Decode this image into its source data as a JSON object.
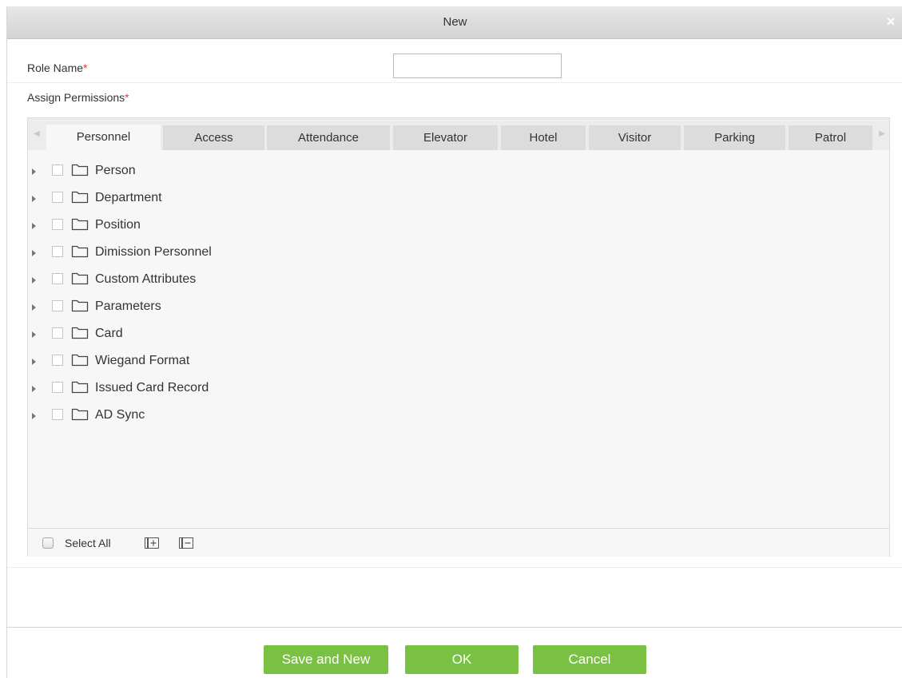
{
  "dialog": {
    "title": "New",
    "close_glyph": "×"
  },
  "form": {
    "role_name_label": "Role Name",
    "required_mark": "*",
    "role_name_value": "",
    "assign_label": "Assign Permissions"
  },
  "tabs": [
    {
      "label": "Personnel",
      "active": true
    },
    {
      "label": "Access"
    },
    {
      "label": "Attendance"
    },
    {
      "label": "Elevator"
    },
    {
      "label": "Hotel"
    },
    {
      "label": "Visitor"
    },
    {
      "label": "Parking"
    },
    {
      "label": "Patrol"
    }
  ],
  "tree": {
    "items": [
      {
        "label": "Person"
      },
      {
        "label": "Department"
      },
      {
        "label": "Position"
      },
      {
        "label": "Dimission Personnel"
      },
      {
        "label": "Custom Attributes"
      },
      {
        "label": "Parameters"
      },
      {
        "label": "Card"
      },
      {
        "label": "Wiegand Format"
      },
      {
        "label": "Issued Card Record"
      },
      {
        "label": "AD Sync"
      }
    ]
  },
  "toolbar": {
    "select_all_label": "Select All",
    "expand_icon": "expand-all-icon",
    "collapse_icon": "collapse-all-icon"
  },
  "buttons": {
    "save_new": "Save and New",
    "ok": "OK",
    "cancel": "Cancel"
  },
  "colors": {
    "accent_green": "#7ac143",
    "required_red": "#e53b3b"
  }
}
